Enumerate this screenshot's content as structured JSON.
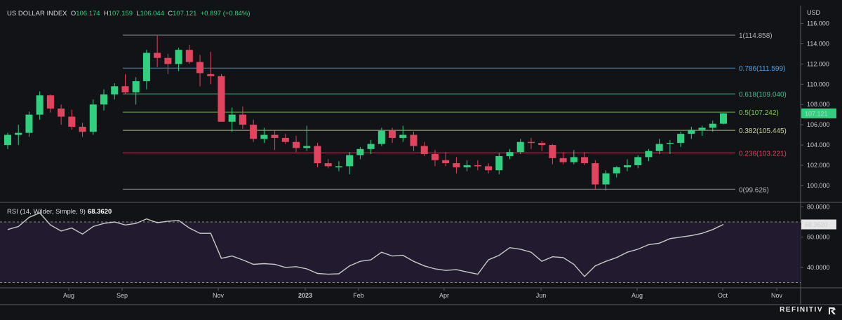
{
  "header": {
    "instrument": "US DOLLAR INDEX",
    "o_label": "O",
    "o_value": "106.174",
    "h_label": "H",
    "h_value": "107.159",
    "l_label": "L",
    "l_value": "106.044",
    "c_label": "C",
    "c_value": "107.121",
    "change": "+0.897 (+0.84%)",
    "currency": "USD"
  },
  "colors": {
    "up": "#2fd07f",
    "down": "#e2445f",
    "background": "#121316",
    "rsi_fill": "#221b2f",
    "rsi_line": "#c8c8c8"
  },
  "brand": "REFINITIV",
  "chart_data": [
    {
      "type": "candlestick",
      "title": "US DOLLAR INDEX",
      "y_unit": "USD",
      "ylim": [
        98.4,
        116.8
      ],
      "yticks": [
        "116.000",
        "114.000",
        "112.000",
        "110.000",
        "108.000",
        "106.000",
        "104.000",
        "102.000",
        "100.000"
      ],
      "x_labels": [
        "Aug",
        "Sep",
        "Nov",
        "2023",
        "Feb",
        "Apr",
        "Jun",
        "Aug",
        "Oct",
        "Nov"
      ],
      "last_price_label": "107.121",
      "fib_levels": [
        {
          "label": "1(114.858)",
          "value": 114.858,
          "color": "#9aa0a6"
        },
        {
          "label": "0.786(111.599)",
          "value": 111.599,
          "color": "#4fa3e8"
        },
        {
          "label": "0.618(109.040)",
          "value": 109.04,
          "color": "#3fbf8f"
        },
        {
          "label": "0.5(107.242)",
          "value": 107.242,
          "color": "#7dcf4f"
        },
        {
          "label": "0.382(105.445)",
          "value": 105.445,
          "color": "#c5d4a0"
        },
        {
          "label": "0.236(103.221)",
          "value": 103.221,
          "color": "#e2445f"
        },
        {
          "label": "0(99.626)",
          "value": 99.626,
          "color": "#9aa0a6"
        }
      ],
      "candles": [
        [
          104.0,
          105.2,
          103.6,
          105.0
        ],
        [
          105.0,
          106.0,
          104.0,
          105.2
        ],
        [
          105.2,
          107.3,
          104.8,
          107.0
        ],
        [
          107.0,
          109.3,
          106.5,
          108.9
        ],
        [
          108.9,
          109.0,
          107.2,
          107.6
        ],
        [
          107.6,
          108.0,
          106.0,
          106.8
        ],
        [
          106.8,
          107.5,
          105.5,
          105.8
        ],
        [
          105.8,
          106.2,
          104.8,
          105.3
        ],
        [
          105.3,
          108.5,
          105.0,
          108.0
        ],
        [
          108.0,
          109.5,
          107.4,
          109.0
        ],
        [
          109.0,
          110.1,
          108.5,
          109.8
        ],
        [
          109.8,
          111.0,
          109.0,
          109.2
        ],
        [
          109.2,
          110.7,
          108.0,
          110.3
        ],
        [
          110.3,
          113.4,
          109.5,
          113.1
        ],
        [
          113.1,
          114.8,
          111.7,
          112.6
        ],
        [
          112.6,
          113.0,
          111.0,
          112.0
        ],
        [
          112.0,
          113.6,
          111.3,
          113.4
        ],
        [
          113.4,
          113.9,
          112.0,
          112.2
        ],
        [
          112.2,
          112.9,
          109.8,
          111.1
        ],
        [
          111.0,
          113.2,
          110.0,
          110.8
        ],
        [
          110.8,
          111.0,
          106.3,
          106.3
        ],
        [
          106.3,
          107.7,
          105.3,
          107.0
        ],
        [
          107.0,
          107.8,
          105.6,
          106.0
        ],
        [
          106.0,
          106.5,
          104.3,
          104.6
        ],
        [
          104.6,
          105.7,
          104.2,
          105.0
        ],
        [
          105.0,
          105.4,
          103.5,
          104.7
        ],
        [
          104.7,
          105.1,
          104.1,
          104.3
        ],
        [
          104.3,
          104.9,
          103.3,
          103.7
        ],
        [
          103.7,
          105.9,
          103.4,
          103.9
        ],
        [
          103.9,
          104.2,
          101.8,
          102.2
        ],
        [
          102.2,
          102.6,
          101.7,
          101.9
        ],
        [
          101.9,
          102.4,
          101.4,
          101.9
        ],
        [
          101.9,
          103.3,
          101.1,
          103.0
        ],
        [
          103.0,
          103.8,
          102.6,
          103.6
        ],
        [
          103.6,
          104.5,
          103.1,
          104.1
        ],
        [
          104.1,
          105.7,
          103.9,
          105.4
        ],
        [
          105.4,
          105.7,
          104.2,
          104.7
        ],
        [
          104.7,
          105.9,
          104.3,
          105.0
        ],
        [
          105.0,
          105.3,
          103.4,
          103.9
        ],
        [
          103.9,
          104.3,
          102.9,
          103.1
        ],
        [
          103.1,
          103.5,
          101.9,
          102.5
        ],
        [
          102.5,
          103.3,
          101.9,
          102.2
        ],
        [
          102.2,
          102.8,
          101.2,
          101.8
        ],
        [
          101.8,
          102.5,
          101.4,
          102.0
        ],
        [
          102.0,
          102.5,
          101.5,
          101.9
        ],
        [
          101.9,
          102.2,
          101.2,
          101.5
        ],
        [
          101.5,
          103.2,
          101.1,
          102.9
        ],
        [
          102.9,
          103.6,
          102.6,
          103.3
        ],
        [
          103.3,
          104.6,
          103.1,
          104.3
        ],
        [
          104.3,
          104.7,
          103.6,
          104.2
        ],
        [
          104.2,
          104.4,
          103.4,
          104.0
        ],
        [
          104.0,
          104.1,
          102.1,
          102.7
        ],
        [
          102.7,
          103.3,
          102.1,
          102.3
        ],
        [
          102.3,
          103.5,
          102.1,
          102.8
        ],
        [
          102.8,
          103.3,
          102.0,
          102.2
        ],
        [
          102.2,
          102.5,
          99.6,
          100.1
        ],
        [
          100.1,
          101.5,
          99.5,
          101.2
        ],
        [
          101.2,
          101.9,
          100.8,
          101.8
        ],
        [
          101.8,
          102.6,
          101.4,
          102.0
        ],
        [
          102.0,
          103.0,
          101.7,
          102.8
        ],
        [
          102.8,
          103.6,
          102.4,
          103.4
        ],
        [
          103.4,
          104.6,
          103.1,
          104.1
        ],
        [
          104.1,
          104.5,
          103.1,
          104.2
        ],
        [
          104.2,
          105.3,
          103.8,
          105.1
        ],
        [
          105.1,
          105.8,
          104.6,
          105.5
        ],
        [
          105.5,
          105.9,
          104.9,
          105.7
        ],
        [
          105.7,
          106.4,
          105.3,
          106.1
        ],
        [
          106.1,
          107.159,
          106.044,
          107.121
        ]
      ]
    },
    {
      "type": "line",
      "title": "RSI (14, Wilder, Simple, 9)",
      "series": [
        {
          "name": "RSI",
          "values": [
            65.0,
            67.0,
            73.0,
            76.0,
            68.0,
            64.0,
            66.0,
            62.0,
            67.0,
            69.0,
            70.0,
            68.0,
            69.0,
            72.0,
            69.5,
            70.5,
            71.0,
            66.0,
            62.5,
            62.5,
            46.0,
            47.5,
            45.0,
            42.0,
            42.5,
            42.0,
            40.0,
            40.5,
            39.0,
            36.0,
            35.5,
            35.8,
            41.0,
            44.0,
            45.0,
            50.0,
            47.5,
            48.0,
            44.0,
            41.0,
            39.0,
            38.0,
            38.5,
            37.0,
            35.5,
            45.0,
            48.0,
            53.0,
            52.0,
            50.0,
            44.0,
            47.0,
            46.5,
            42.0,
            34.0,
            41.0,
            44.0,
            46.5,
            50.0,
            52.0,
            55.0,
            56.0,
            59.0,
            60.0,
            61.0,
            62.5,
            65.0,
            68.362
          ]
        }
      ],
      "last_value_label": "68.3620",
      "ylim": [
        27,
        82
      ],
      "yticks": [
        "80.0000",
        "60.0000",
        "40.0000"
      ],
      "reference_levels": [
        70,
        30
      ]
    }
  ]
}
